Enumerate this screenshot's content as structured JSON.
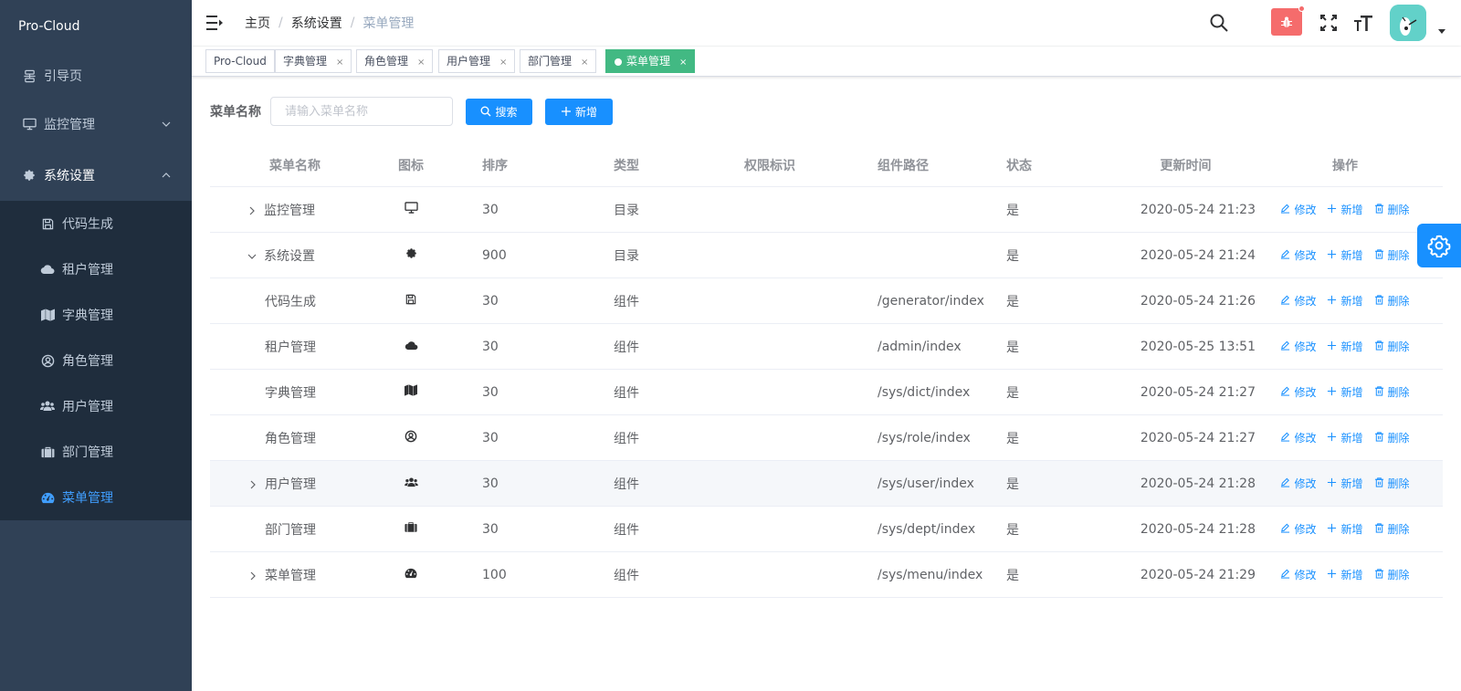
{
  "sidebar": {
    "logo": "Pro-Cloud",
    "items": [
      {
        "label": "引导页",
        "icon": "guide-icon"
      },
      {
        "label": "监控管理",
        "icon": "monitor-icon"
      },
      {
        "label": "系统设置",
        "icon": "gear-icon"
      }
    ],
    "submenu": [
      {
        "label": "代码生成",
        "icon": "save-icon"
      },
      {
        "label": "租户管理",
        "icon": "cloud-icon"
      },
      {
        "label": "字典管理",
        "icon": "map-icon"
      },
      {
        "label": "角色管理",
        "icon": "user-circle-icon"
      },
      {
        "label": "用户管理",
        "icon": "users-icon"
      },
      {
        "label": "部门管理",
        "icon": "briefcase-icon"
      },
      {
        "label": "菜单管理",
        "icon": "dashboard-icon"
      }
    ]
  },
  "navbar": {
    "breadcrumb": [
      "主页",
      "系统设置",
      "菜单管理"
    ]
  },
  "tags": [
    {
      "label": "Pro-Cloud"
    },
    {
      "label": "字典管理"
    },
    {
      "label": "角色管理"
    },
    {
      "label": "用户管理"
    },
    {
      "label": "部门管理"
    },
    {
      "label": "菜单管理"
    }
  ],
  "search": {
    "label": "菜单名称",
    "placeholder": "请输入菜单名称",
    "search_btn": "搜索",
    "add_btn": "新增"
  },
  "table": {
    "headers": {
      "name": "菜单名称",
      "icon": "图标",
      "sort": "排序",
      "type": "类型",
      "perm": "权限标识",
      "path": "组件路径",
      "status": "状态",
      "time": "更新时间",
      "ops": "操作"
    },
    "ops": {
      "edit": "修改",
      "add": "新增",
      "delete": "删除"
    },
    "rows": [
      {
        "name": "监控管理",
        "icon": "monitor-icon",
        "sort": "30",
        "type": "目录",
        "perm": "",
        "path": "",
        "status": "是",
        "time": "2020-05-24 21:23"
      },
      {
        "name": "系统设置",
        "icon": "gear-icon",
        "sort": "900",
        "type": "目录",
        "perm": "",
        "path": "",
        "status": "是",
        "time": "2020-05-24 21:24"
      },
      {
        "name": "代码生成",
        "icon": "save-icon",
        "sort": "30",
        "type": "组件",
        "perm": "",
        "path": "/generator/index",
        "status": "是",
        "time": "2020-05-24 21:26"
      },
      {
        "name": "租户管理",
        "icon": "cloud-icon",
        "sort": "30",
        "type": "组件",
        "perm": "",
        "path": "/admin/index",
        "status": "是",
        "time": "2020-05-25 13:51"
      },
      {
        "name": "字典管理",
        "icon": "map-icon",
        "sort": "30",
        "type": "组件",
        "perm": "",
        "path": "/sys/dict/index",
        "status": "是",
        "time": "2020-05-24 21:27"
      },
      {
        "name": "角色管理",
        "icon": "user-circle-icon",
        "sort": "30",
        "type": "组件",
        "perm": "",
        "path": "/sys/role/index",
        "status": "是",
        "time": "2020-05-24 21:27"
      },
      {
        "name": "用户管理",
        "icon": "users-icon",
        "sort": "30",
        "type": "组件",
        "perm": "",
        "path": "/sys/user/index",
        "status": "是",
        "time": "2020-05-24 21:28"
      },
      {
        "name": "部门管理",
        "icon": "briefcase-icon",
        "sort": "30",
        "type": "组件",
        "perm": "",
        "path": "/sys/dept/index",
        "status": "是",
        "time": "2020-05-24 21:28"
      },
      {
        "name": "菜单管理",
        "icon": "dashboard-icon",
        "sort": "100",
        "type": "组件",
        "perm": "",
        "path": "/sys/menu/index",
        "status": "是",
        "time": "2020-05-24 21:29"
      }
    ]
  },
  "colors": {
    "sidebar_bg": "#304156",
    "submenu_bg": "#1f2d3d",
    "primary": "#1890ff",
    "active_tag": "#42b983",
    "bug": "#f56c6c"
  }
}
